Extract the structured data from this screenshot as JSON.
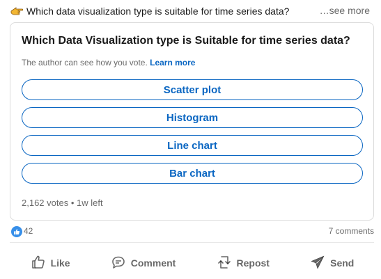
{
  "post": {
    "text": "Which data visualization type is suitable for time series data?",
    "see_more": "…see more"
  },
  "poll": {
    "question": "Which Data Visualization type is Suitable for time series data?",
    "note": "The author can see how you vote.",
    "learn_more": "Learn more",
    "options": [
      "Scatter plot",
      "Histogram",
      "Line chart",
      "Bar chart"
    ],
    "votes": "2,162 votes",
    "separator": "•",
    "time_left": "1w left"
  },
  "social": {
    "reaction_count": "42",
    "comments": "7 comments"
  },
  "actions": {
    "like": "Like",
    "comment": "Comment",
    "repost": "Repost",
    "send": "Send"
  },
  "colors": {
    "accent": "#0a66c2",
    "like_badge": "#378fe9",
    "pointing_hand": "#f2b632"
  }
}
